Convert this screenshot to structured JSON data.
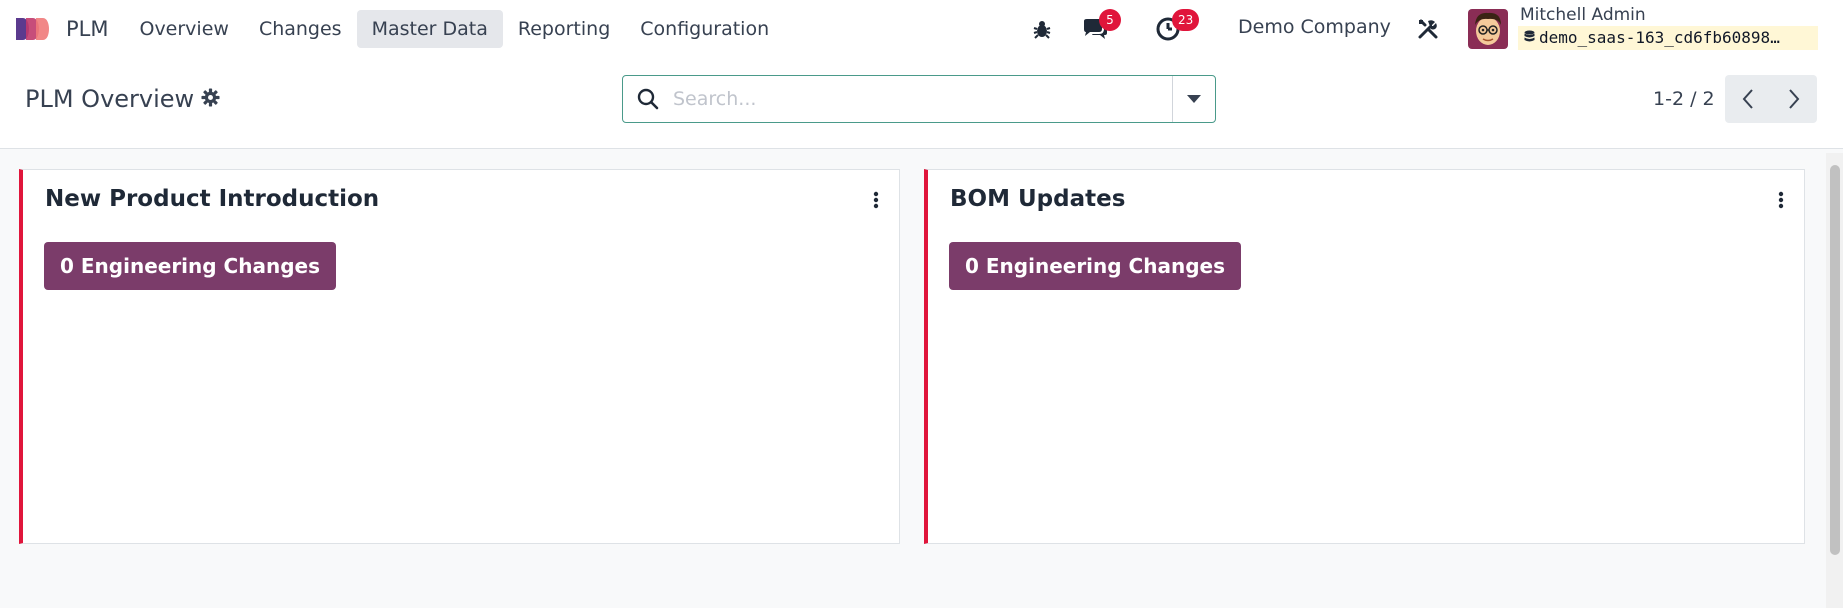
{
  "navbar": {
    "app_name": "PLM",
    "menu": [
      {
        "label": "Overview",
        "active": false
      },
      {
        "label": "Changes",
        "active": false
      },
      {
        "label": "Master Data",
        "active": true
      },
      {
        "label": "Reporting",
        "active": false
      },
      {
        "label": "Configuration",
        "active": false
      }
    ],
    "debug_icon": "bug-icon",
    "messages_icon": "chat-icon",
    "messages_count": "5",
    "activities_icon": "clock-icon",
    "activities_count": "23",
    "company": "Demo Company",
    "settings_icon": "tools-icon",
    "user_name": "Mitchell Admin",
    "database": "demo_saas-163_cd6fb60898…"
  },
  "control_panel": {
    "title": "PLM Overview",
    "gear_icon": "gear-icon",
    "search_placeholder": "Search...",
    "search_value": "",
    "pager": "1-2 / 2"
  },
  "kanban": [
    {
      "title": "New Product Introduction",
      "button": "0 Engineering Changes"
    },
    {
      "title": "BOM Updates",
      "button": "0 Engineering Changes"
    }
  ],
  "colors": {
    "accent": "#7b3c6a",
    "card_border": "#e0153b",
    "badge": "#e0153b"
  }
}
